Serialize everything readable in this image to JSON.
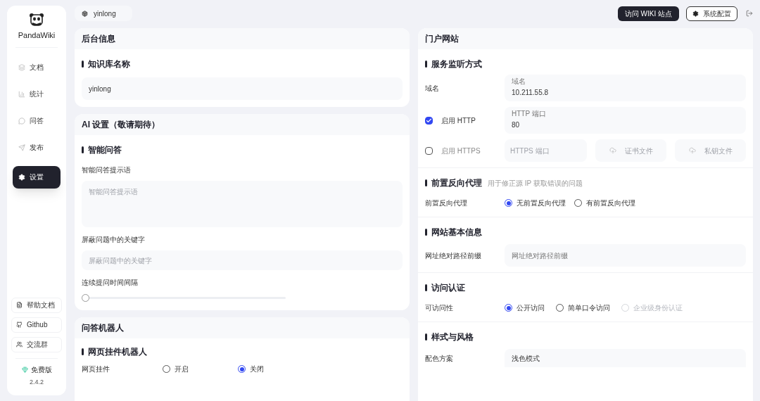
{
  "sidebar": {
    "logo_text": "PandaWiki",
    "nav": [
      {
        "label": "文档",
        "selected": false
      },
      {
        "label": "统计",
        "selected": false
      },
      {
        "label": "问答",
        "selected": false
      },
      {
        "label": "发布",
        "selected": false
      },
      {
        "label": "设置",
        "selected": true
      }
    ],
    "links": [
      {
        "label": "帮助文档"
      },
      {
        "label": "Github"
      },
      {
        "label": "交流群"
      }
    ],
    "edition": "免费版",
    "version": "2.4.2"
  },
  "topbar": {
    "kb_name": "yinlong",
    "visit_button": "访问 WIKI 站点",
    "config_button": "系统配置"
  },
  "backend_card": {
    "title": "后台信息",
    "section": "知识库名称",
    "name_value": "yinlong"
  },
  "ai_card": {
    "title": "AI 设置（敬请期待）",
    "section": "智能问答",
    "prompt_label": "智能问答提示语",
    "prompt_placeholder": "智能问答提示语",
    "keywords_label": "屏蔽问题中的关键字",
    "keywords_placeholder": "屏蔽问题中的关键字",
    "interval_label": "连续提问时间间隔",
    "interval": {
      "level": 0
    }
  },
  "bot_card": {
    "title": "问答机器人",
    "section": "网页挂件机器人",
    "row_label": "网页挂件",
    "options": [
      {
        "label": "开启",
        "selected": false
      },
      {
        "label": "关闭",
        "selected": true
      }
    ]
  },
  "portal_card": {
    "title": "门户网站",
    "listen": {
      "section": "服务监听方式",
      "domain_label": "域名",
      "domain_float": "域名",
      "domain_value": "10.211.55.8",
      "http": {
        "label": "启用 HTTP",
        "checked": true,
        "float": "HTTP 端口",
        "value": "80"
      },
      "https": {
        "label": "启用 HTTPS",
        "checked": false,
        "placeholder": "HTTPS 端口",
        "cert": "证书文件",
        "key": "私钥文件"
      }
    },
    "proxy": {
      "section": "前置反向代理",
      "hint": "用于修正源 IP 获取错误的问题",
      "row_label": "前置反向代理",
      "options": [
        {
          "label": "无前置反向代理",
          "selected": true,
          "disabled": false
        },
        {
          "label": "有前置反向代理",
          "selected": false,
          "disabled": false
        }
      ]
    },
    "basic": {
      "section": "网站基本信息",
      "row_label": "网址绝对路径前缀",
      "placeholder": "网址绝对路径前缀"
    },
    "auth": {
      "section": "访问认证",
      "row_label": "可访问性",
      "options": [
        {
          "label": "公开访问",
          "selected": true,
          "disabled": false
        },
        {
          "label": "简单口令访问",
          "selected": false,
          "disabled": false
        },
        {
          "label": "企业级身份认证",
          "selected": false,
          "disabled": true
        }
      ]
    },
    "style": {
      "section": "样式与风格",
      "row_label": "配色方案",
      "value": "浅色模式"
    }
  }
}
